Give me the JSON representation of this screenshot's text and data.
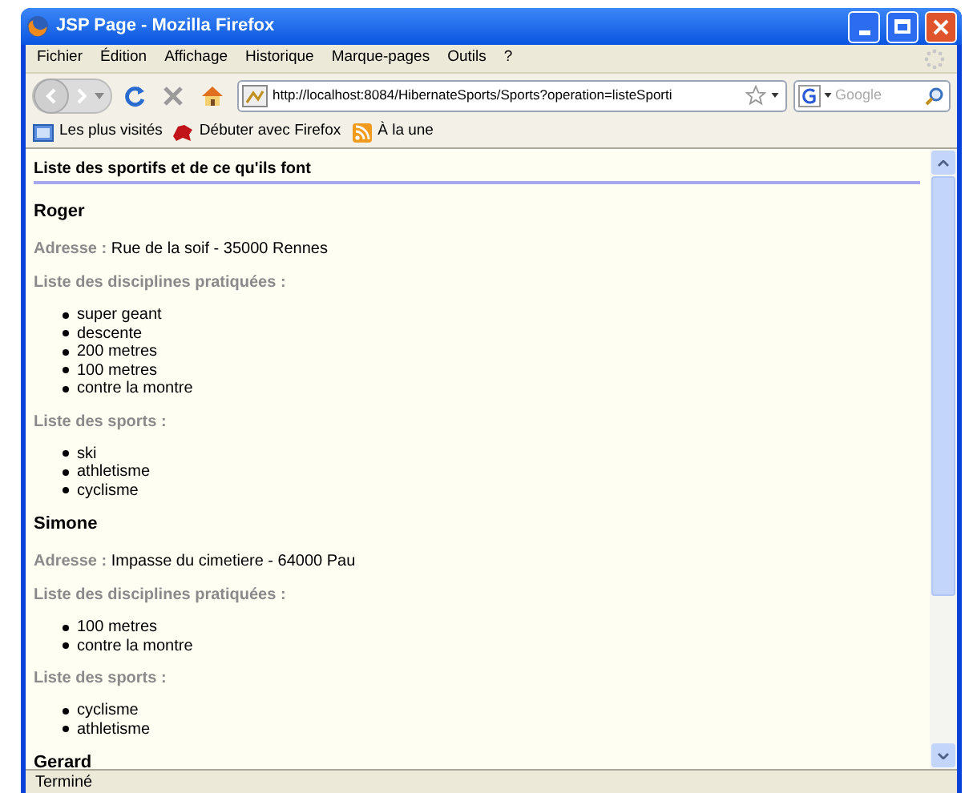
{
  "window": {
    "title": "JSP Page - Mozilla Firefox"
  },
  "menu": [
    "Fichier",
    "Édition",
    "Affichage",
    "Historique",
    "Marque-pages",
    "Outils",
    "?"
  ],
  "address_bar": {
    "value": "http://localhost:8084/HibernateSports/Sports?operation=listeSporti"
  },
  "search": {
    "placeholder": "Google"
  },
  "bookmarks": [
    {
      "kind": "page",
      "label": "Les plus visités"
    },
    {
      "kind": "firefox",
      "label": "Débuter avec Firefox"
    },
    {
      "kind": "feed",
      "label": "À la une"
    }
  ],
  "page": {
    "heading": "Liste des sportifs et de ce qu'ils font",
    "people": [
      {
        "name": "Roger",
        "address_label": "Adresse :",
        "address": "Rue de la soif - 35000 Rennes",
        "disciplines_label": "Liste des disciplines pratiquées :",
        "disciplines": [
          "super geant",
          "descente",
          "200 metres",
          "100 metres",
          "contre la montre"
        ],
        "sports_label": "Liste des sports :",
        "sports": [
          "ski",
          "athletisme",
          "cyclisme"
        ]
      },
      {
        "name": "Simone",
        "address_label": "Adresse :",
        "address": "Impasse du cimetiere - 64000 Pau",
        "disciplines_label": "Liste des disciplines pratiquées :",
        "disciplines": [
          "100 metres",
          "contre la montre"
        ],
        "sports_label": "Liste des sports :",
        "sports": [
          "cyclisme",
          "athletisme"
        ]
      },
      {
        "name": "Gerard"
      }
    ]
  },
  "status_bar": {
    "text": "Terminé"
  }
}
